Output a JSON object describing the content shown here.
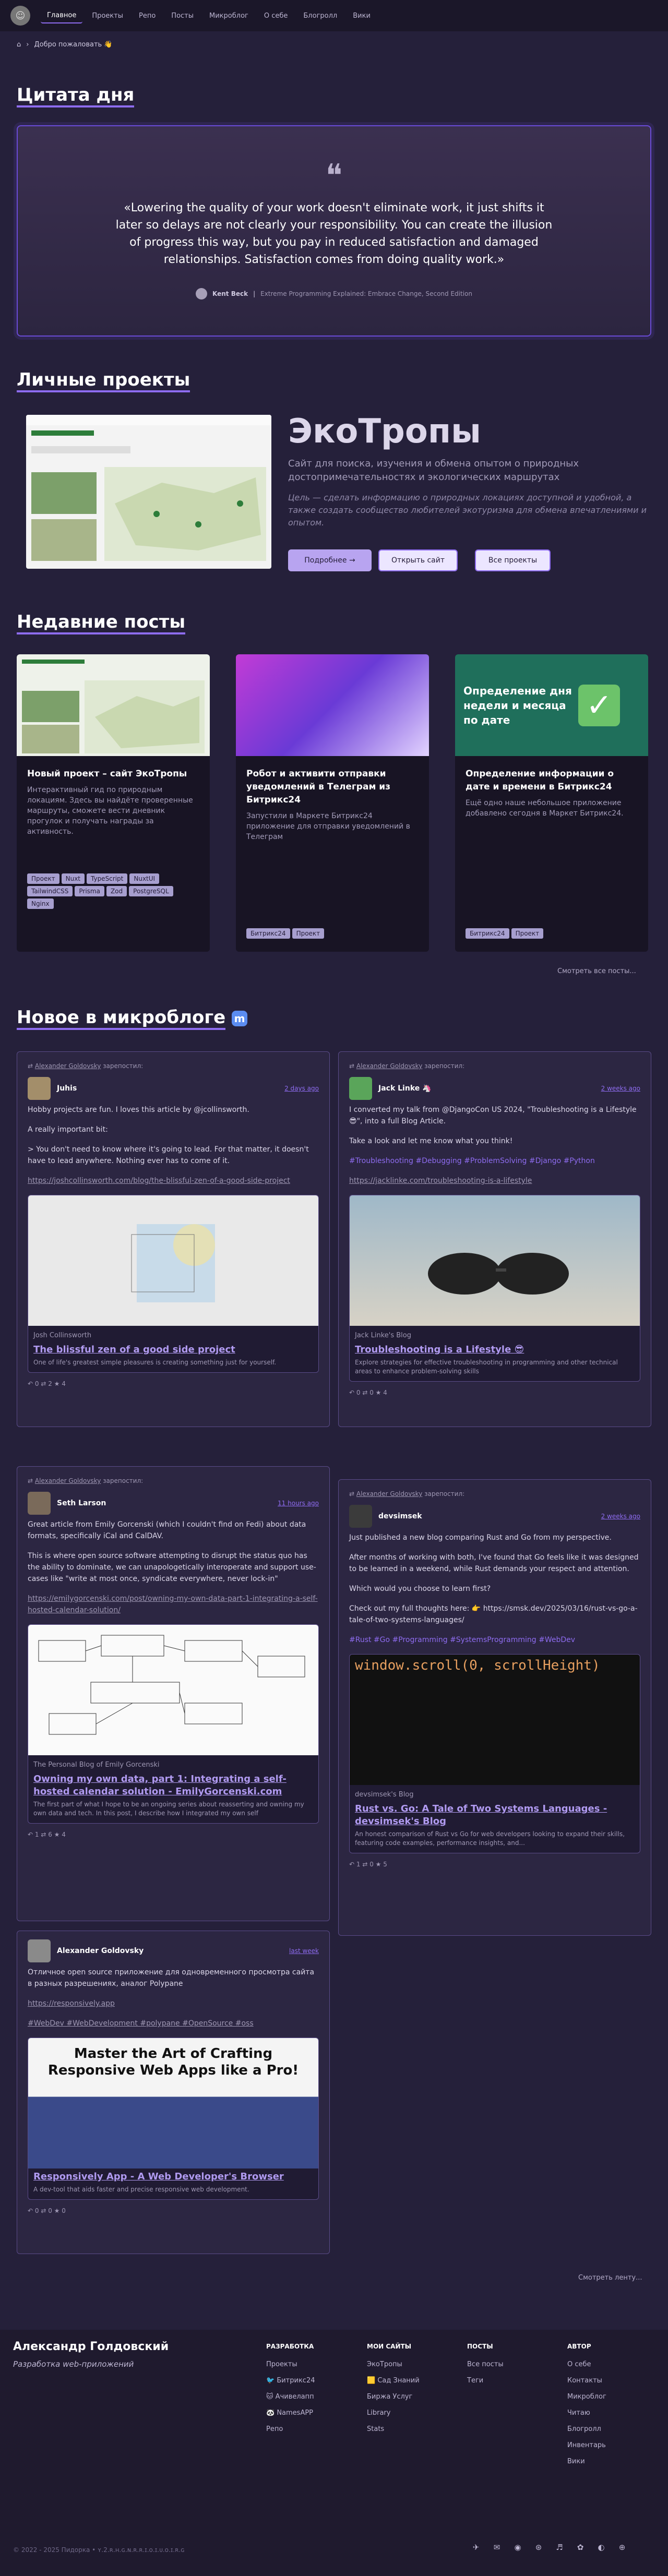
{
  "nav": {
    "items": [
      "Главное",
      "Проекты",
      "Репо",
      "Посты",
      "Микроблог",
      "О себе",
      "Блогролл",
      "Вики"
    ]
  },
  "breadcrumb": {
    "home": "⌂",
    "current": "Добро пожаловать 👋"
  },
  "quote_section": {
    "title": "Цитата дня",
    "text": "«Lowering the quality of your work doesn't eliminate work, it just shifts it later so delays are not clearly your responsibility. You can create the illusion of progress this way, but you pay in reduced satisfaction and damaged relationships. Satisfaction comes from doing quality work.»",
    "author": "Kent Beck",
    "source": "Extreme Programming Explained: Embrace Change, Second Edition"
  },
  "projects": {
    "title": "Личные проекты",
    "name": "ЭкоТропы",
    "desc": "Сайт для поиска, изучения и обмена опытом о природных достопримечательностях и экологических маршрутах",
    "desc2": "Цель — сделать информацию о природных локациях доступной и удобной, а также создать сообщество любителей экотуризма для обмена впечатлениями и опытом.",
    "btn_more": "Подробнее →",
    "btn_open": "Открыть сайт",
    "btn_all": "Все проекты"
  },
  "posts": {
    "title": "Недавние посты",
    "more": "Смотреть все посты...",
    "items": [
      {
        "title": "Новый проект – сайт ЭкоТропы",
        "desc": "Интерактивный гид по природным локациям. Здесь вы найдёте проверенные маршруты, сможете вести дневник прогулок и получать награды за активность.",
        "tags": [
          "Проект",
          "Nuxt",
          "TypeScript",
          "NuxtUI",
          "TailwindCSS",
          "Prisma",
          "Zod",
          "PostgreSQL",
          "Nginx"
        ]
      },
      {
        "title": "Робот и активити отправки уведомлений в Телеграм из Битрикс24",
        "desc": "Запустили в Маркете Битрикс24 приложение для отправки уведомлений в Телеграм",
        "tags": [
          "Битрикс24",
          "Проект"
        ]
      },
      {
        "title": "Определение информации о дате и времени в Битрикс24",
        "desc": "Ещё одно наше небольшое приложение добавлено сегодня в Маркет Битрикс24.",
        "tags": [
          "Битрикс24",
          "Проект"
        ],
        "img_text": "Определение дня недели и месяца по дате"
      }
    ]
  },
  "micro": {
    "title": "Новое в микроблоге",
    "more": "Смотреть ленту...",
    "reposted": "зарепостил:",
    "reposter": "Alexander Goldovsky",
    "cards": [
      {
        "name": "Juhis",
        "time": "2 days ago",
        "paras": [
          "Hobby projects are fun. I loves this article by @jcollinsworth.",
          "A really important bit:",
          "> You don't need to know where it's going to lead. For that matter, it doesn't have to lead anywhere. Nothing ever has to come of it."
        ],
        "link": "https://joshcollinsworth.com/blog/the-blissful-zen-of-a-good-side-project",
        "site": "Josh Collinsworth",
        "ptitle": "The blissful zen of a good side project",
        "pdesc": "One of life's greatest simple pleasures is creating something just for yourself.",
        "foot": "↶ 0  ⇄ 2  ★ 4"
      },
      {
        "name": "Jack Linke 🦄",
        "time": "2 weeks ago",
        "paras": [
          "I converted my talk from @DjangoCon US 2024, \"Troubleshooting is a Lifestyle 😎\", into a full Blog Article.",
          "Take a look and let me know what you think!"
        ],
        "tags": "#Troubleshooting #Debugging #ProblemSolving #Django #Python",
        "link": "https://jacklinke.com/troubleshooting-is-a-lifestyle",
        "site": "Jack Linke's Blog",
        "ptitle": "Troubleshooting is a Lifestyle 😎",
        "pdesc": "Explore strategies for effective troubleshooting in programming and other technical areas to enhance problem-solving skills",
        "foot": "↶ 0  ⇄ 0  ★ 4"
      },
      {
        "name": "Seth Larson",
        "time": "11 hours ago",
        "paras": [
          "Great article from Emily Gorcenski (which I couldn't find on Fedi) about data formats, specifically iCal and CalDAV.",
          "This is where open source software attempting to disrupt the status quo has the ability to dominate, we can unapologetically interoperate and support use-cases like \"write at most once, syndicate everywhere, never lock-in\""
        ],
        "link": "https://emilygorcenski.com/post/owning-my-own-data-part-1-integrating-a-self-hosted-calendar-solution/",
        "site": "The Personal Blog of Emily Gorcenski",
        "ptitle": "Owning my own data, part 1: Integrating a self-hosted calendar solution - EmilyGorcenski.com",
        "pdesc": "The first part of what I hope to be an ongoing series about reasserting and owning my own data and tech. In this post, I describe how I integrated my own self",
        "foot": "↶ 1  ⇄ 6  ★ 4"
      },
      {
        "name": "devsimsek",
        "time": "2 weeks ago",
        "paras": [
          "Just published a new blog comparing Rust and Go from my perspective.",
          "After months of working with both, I've found that Go feels like it was designed to be learned in a weekend, while Rust demands your respect and attention.",
          "Which would you choose to learn first?",
          "Check out my full thoughts here: 👉 https://smsk.dev/2025/03/16/rust-vs-go-a-tale-of-two-systems-languages/"
        ],
        "tags": "#Rust #Go #Programming #SystemsProgramming #WebDev",
        "site": "devsimsek's Blog",
        "ptitle": "Rust vs. Go: A Tale of Two Systems Languages - devsimsek's Blog",
        "pdesc": "An honest comparison of Rust vs Go for web developers looking to expand their skills, featuring code examples, performance insights, and...",
        "foot": "↶ 1  ⇄ 0  ★ 5",
        "code": "window.scroll(0, scrollHeight)"
      },
      {
        "name": "Alexander Goldovsky",
        "time": "last week",
        "paras": [
          "Отличное open source приложение для одновременного просмотра сайта в разных разрешениях, аналог Polypane"
        ],
        "link": "https://responsively.app",
        "tags": "#WebDev #WebDevelopment #polypane #OpenSource #oss",
        "pimg_title": "Master the Art of Crafting Responsive Web Apps like a Pro!",
        "ptitle": "Responsively App - A Web Developer's Browser",
        "pdesc": "A dev-tool that aids faster and precise responsive web development.",
        "foot": "↶ 0  ⇄ 0  ★ 0"
      }
    ]
  },
  "footer": {
    "brand": "Александр Голдовский",
    "slogan": "Разработка web-приложений",
    "cols": [
      {
        "head": "РАЗРАБОТКА",
        "items": [
          "Проекты",
          "🐦 Битрикс24",
          "🐱 Ачивелапп",
          "🐼 NamesAPP",
          "Репо"
        ]
      },
      {
        "head": "МОИ САЙТЫ",
        "items": [
          "ЭкоТропы",
          "🟨 Сад Знаний",
          "Биржа Услуг",
          "Library",
          "Stats"
        ]
      },
      {
        "head": "ПОСТЫ",
        "items": [
          "Все посты",
          "Теги"
        ]
      },
      {
        "head": "АВТОР",
        "items": [
          "О себе",
          "Контакты",
          "Микроблог",
          "Читаю",
          "Блогролл",
          "Инвентарь",
          "Вики"
        ]
      }
    ],
    "copyright": "© 2022 - 2025 Пидорка • ʏ.2.ʀ.ʜ.ɢ.ɴ.ʀ.ʀ.ɪ.ᴏ.ɪ.ᴜ.ᴏ.ɪ.ʀ.ɢ",
    "social": [
      "✈",
      "✉",
      "◉",
      "⊛",
      "♬",
      "✿",
      "◐",
      "⊕"
    ]
  }
}
